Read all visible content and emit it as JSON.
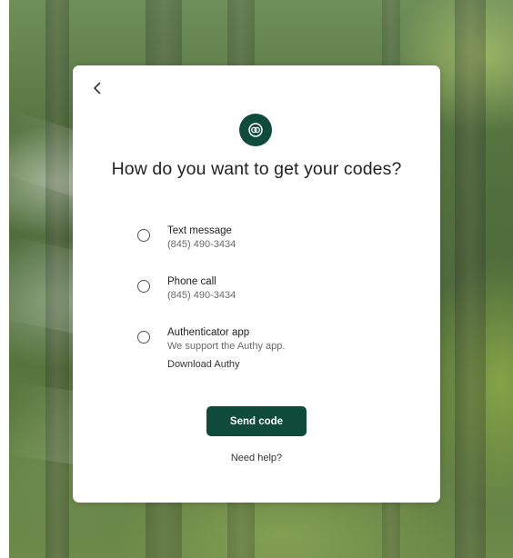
{
  "background": {
    "description_icon": "forest-background"
  },
  "card": {
    "back_icon": "chevron-left-icon",
    "logo_icon": "brand-logo-icon",
    "title": "How do you want to get your codes?",
    "options": [
      {
        "label": "Text message",
        "detail": "(845) 490-3434",
        "selected": false
      },
      {
        "label": "Phone call",
        "detail": "(845) 490-3434",
        "selected": false
      },
      {
        "label": "Authenticator app",
        "detail": "We support the Authy app.",
        "link": "Download Authy",
        "selected": false
      }
    ],
    "send_button": "Send code",
    "help_link": "Need help?"
  },
  "colors": {
    "brand": "#0e4b3b",
    "card": "#ffffff",
    "text": "#222222",
    "muted": "#6a6a6a"
  }
}
